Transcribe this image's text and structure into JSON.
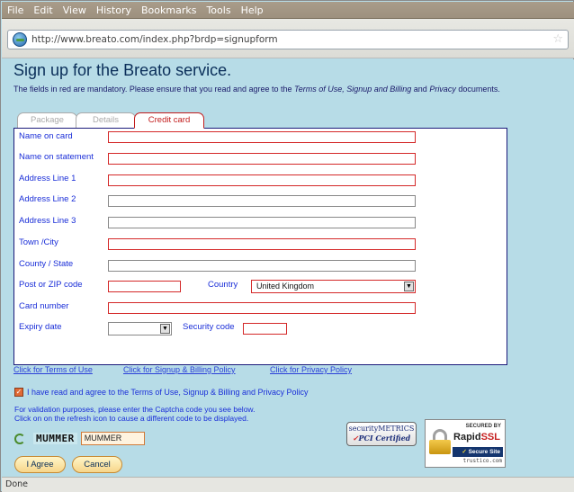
{
  "menubar": {
    "items": [
      "File",
      "Edit",
      "View",
      "History",
      "Bookmarks",
      "Tools",
      "Help"
    ]
  },
  "address": {
    "url": "http://www.breato.com/index.php?brdp=signupform",
    "site_icon": "globe-icon",
    "bookmark_icon": "star-icon"
  },
  "page": {
    "title": "Sign up for the Breato service.",
    "intro_pre": "The fields in red are mandatory.  Please ensure that you read and agree to the ",
    "intro_terms": "Terms of Use, Signup and Billing",
    "intro_mid": " and ",
    "intro_privacy": "Privacy",
    "intro_post": " documents."
  },
  "tabs": [
    {
      "label": "Package",
      "active": false
    },
    {
      "label": "Details",
      "active": false
    },
    {
      "label": "Credit card",
      "active": true
    }
  ],
  "form": {
    "name_on_card": {
      "label": "Name on card",
      "value": "",
      "required": true
    },
    "name_on_statement": {
      "label": "Name on statement",
      "value": "",
      "required": true
    },
    "address1": {
      "label": "Address Line 1",
      "value": "",
      "required": true
    },
    "address2": {
      "label": "Address Line 2",
      "value": "",
      "required": false
    },
    "address3": {
      "label": "Address Line 3",
      "value": "",
      "required": false
    },
    "town": {
      "label": "Town /City",
      "value": "",
      "required": true
    },
    "county": {
      "label": "County / State",
      "value": "",
      "required": false
    },
    "postcode": {
      "label": "Post or ZIP code",
      "value": "",
      "required": true
    },
    "country": {
      "label": "Country",
      "value": "United Kingdom",
      "required": true
    },
    "card_number": {
      "label": "Card number",
      "value": "",
      "required": true
    },
    "expiry": {
      "label": "Expiry date",
      "value": "",
      "required": false
    },
    "security_code": {
      "label": "Security code",
      "value": "",
      "required": true
    }
  },
  "policies": {
    "terms": "Click for Terms of Use",
    "billing": "Click for Signup & Billing Policy",
    "privacy": "Click for Privacy Policy"
  },
  "agree_text": "I have read and agree to the Terms of Use, Signup & Billing and Privacy Policy",
  "agree_checked": true,
  "validation": {
    "line1": "For validation purposes, please enter the Captcha code you see below.",
    "line2": "Click on on the refresh icon to cause a different code to be displayed."
  },
  "captcha": {
    "image_text": "MUMMER",
    "input_value": "MUMMER",
    "refresh_icon": "refresh-icon"
  },
  "buttons": {
    "agree": "I Agree",
    "cancel": "Cancel"
  },
  "badges": {
    "secmetrics_line1": "securityMETRICS",
    "secmetrics_line2": "PCI Certified",
    "ssl_secured": "SECURED BY",
    "ssl_rapid": "Rapid",
    "ssl_ssl": "SSL",
    "ssl_secure_site": "Secure Site",
    "ssl_trustico": "trustico.com"
  },
  "status": "Done",
  "colors": {
    "page_bg": "#b7dce7",
    "required_border": "#d42828",
    "label_blue": "#1a2ed8",
    "title_navy": "#0a2e59"
  }
}
